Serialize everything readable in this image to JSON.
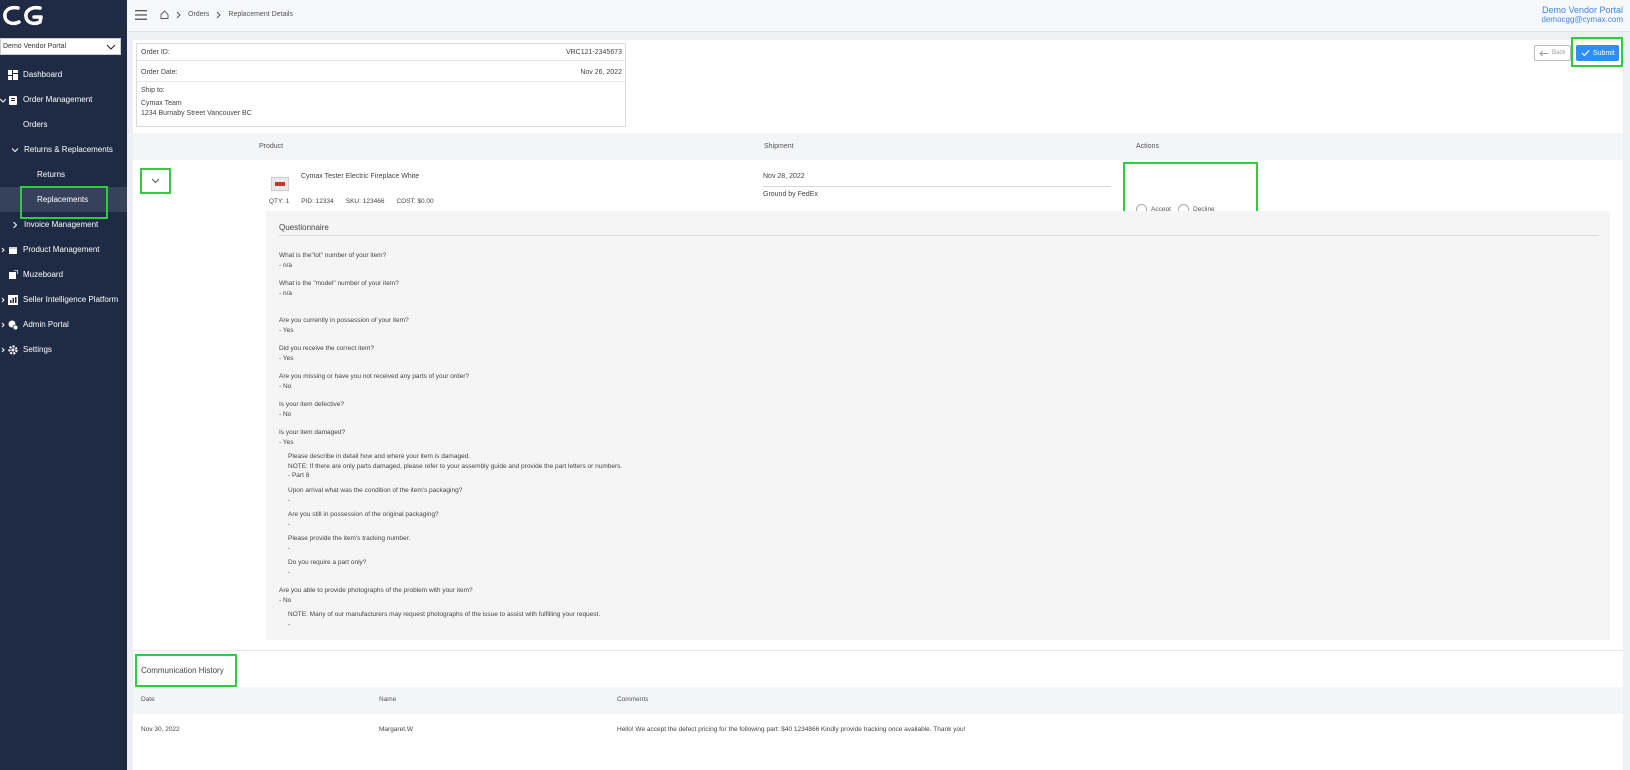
{
  "sidebar": {
    "logo_text": "CG",
    "vendor_select": "Demo Vendor Portal",
    "items": [
      {
        "label": "Dashboard",
        "icon": "dashboard-icon"
      },
      {
        "label": "Order Management",
        "icon": "clipboard-icon"
      },
      {
        "label": "Orders"
      },
      {
        "label": "Returns & Replacements"
      },
      {
        "label": "Returns"
      },
      {
        "label": "Replacements"
      },
      {
        "label": "Invoice Management"
      },
      {
        "label": "Product Management",
        "icon": "box-icon"
      },
      {
        "label": "Muzeboard",
        "icon": "board-icon"
      },
      {
        "label": "Seller Intelligence Platform",
        "icon": "chart-icon"
      },
      {
        "label": "Admin Portal",
        "icon": "admin-icon"
      },
      {
        "label": "Settings",
        "icon": "gear-icon"
      }
    ]
  },
  "topbar": {
    "breadcrumb": [
      "Orders",
      "Replacement Details"
    ],
    "user_name": "Demo Vendor Portal",
    "user_email": "democgg@cymax.com"
  },
  "order": {
    "id_label": "Order ID:",
    "id_value": "VRC121-2345673",
    "date_label": "Order Date:",
    "date_value": "Nov 26, 2022",
    "ship_label": "Ship to:",
    "ship_name": "Cymax Team",
    "ship_address": "1234 Burnaby Street Vancouver BC"
  },
  "buttons": {
    "back": "Back",
    "submit": "Submit"
  },
  "table": {
    "headers": {
      "product": "Product",
      "shipment": "Shipment",
      "actions": "Actions"
    },
    "row": {
      "product_name": "Cymax Tester Electric Fireplace White",
      "qty": "QTY: 1",
      "pid": "PID: 12334",
      "sku": "SKU: 123466",
      "cost": "COST: $0.00",
      "ship_date": "Nov 28, 2022",
      "carrier": "Ground by FedEx",
      "accept": "Accept",
      "decline": "Decline"
    }
  },
  "questionnaire": {
    "title": "Questionnaire",
    "items": [
      "What is the\"lot\" number of your item?\n- n/a",
      "What is the \"model\" number of your item?\n- n/a",
      "Are you currently in possession of your item?\n- Yes",
      "Did you receive the correct item?\n- Yes",
      "Are you missing or have you not received any parts of your order?\n- No",
      "Is your item defective?\n- No",
      "Is your item damaged?\n- Yes",
      "Please describe in detail how and where your item is damaged.\nNOTE: If there are only parts damaged, please refer to your assembly guide and provide the part letters or numbers.\n- Part 8",
      "Upon arrival what was the condition of the item's packaging?\n-",
      "Are you still in possession of the original packaging?\n-",
      "Please provide the item's tracking number.\n-",
      "Do you require a part only?\n-",
      "Are you able to provide photographs of the problem with your item?\n- No",
      "NOTE: Many of our manufacturers may request photographs of the issue to assist with fulfilling your request.\n-"
    ]
  },
  "communication": {
    "title": "Communication History",
    "headers": {
      "date": "Date",
      "name": "Name",
      "comments": "Comments"
    },
    "row": {
      "date": "Nov 30, 2022",
      "name": "Margaret.W",
      "comment": "Hello! We accept the defect pricing for the following part: $40 1234866 Kindly provide tracking once available. Thank you!"
    }
  },
  "colors": {
    "sidebar": "#1f2a44",
    "accent": "#2f8ef0",
    "highlight": "#2ecc40"
  }
}
